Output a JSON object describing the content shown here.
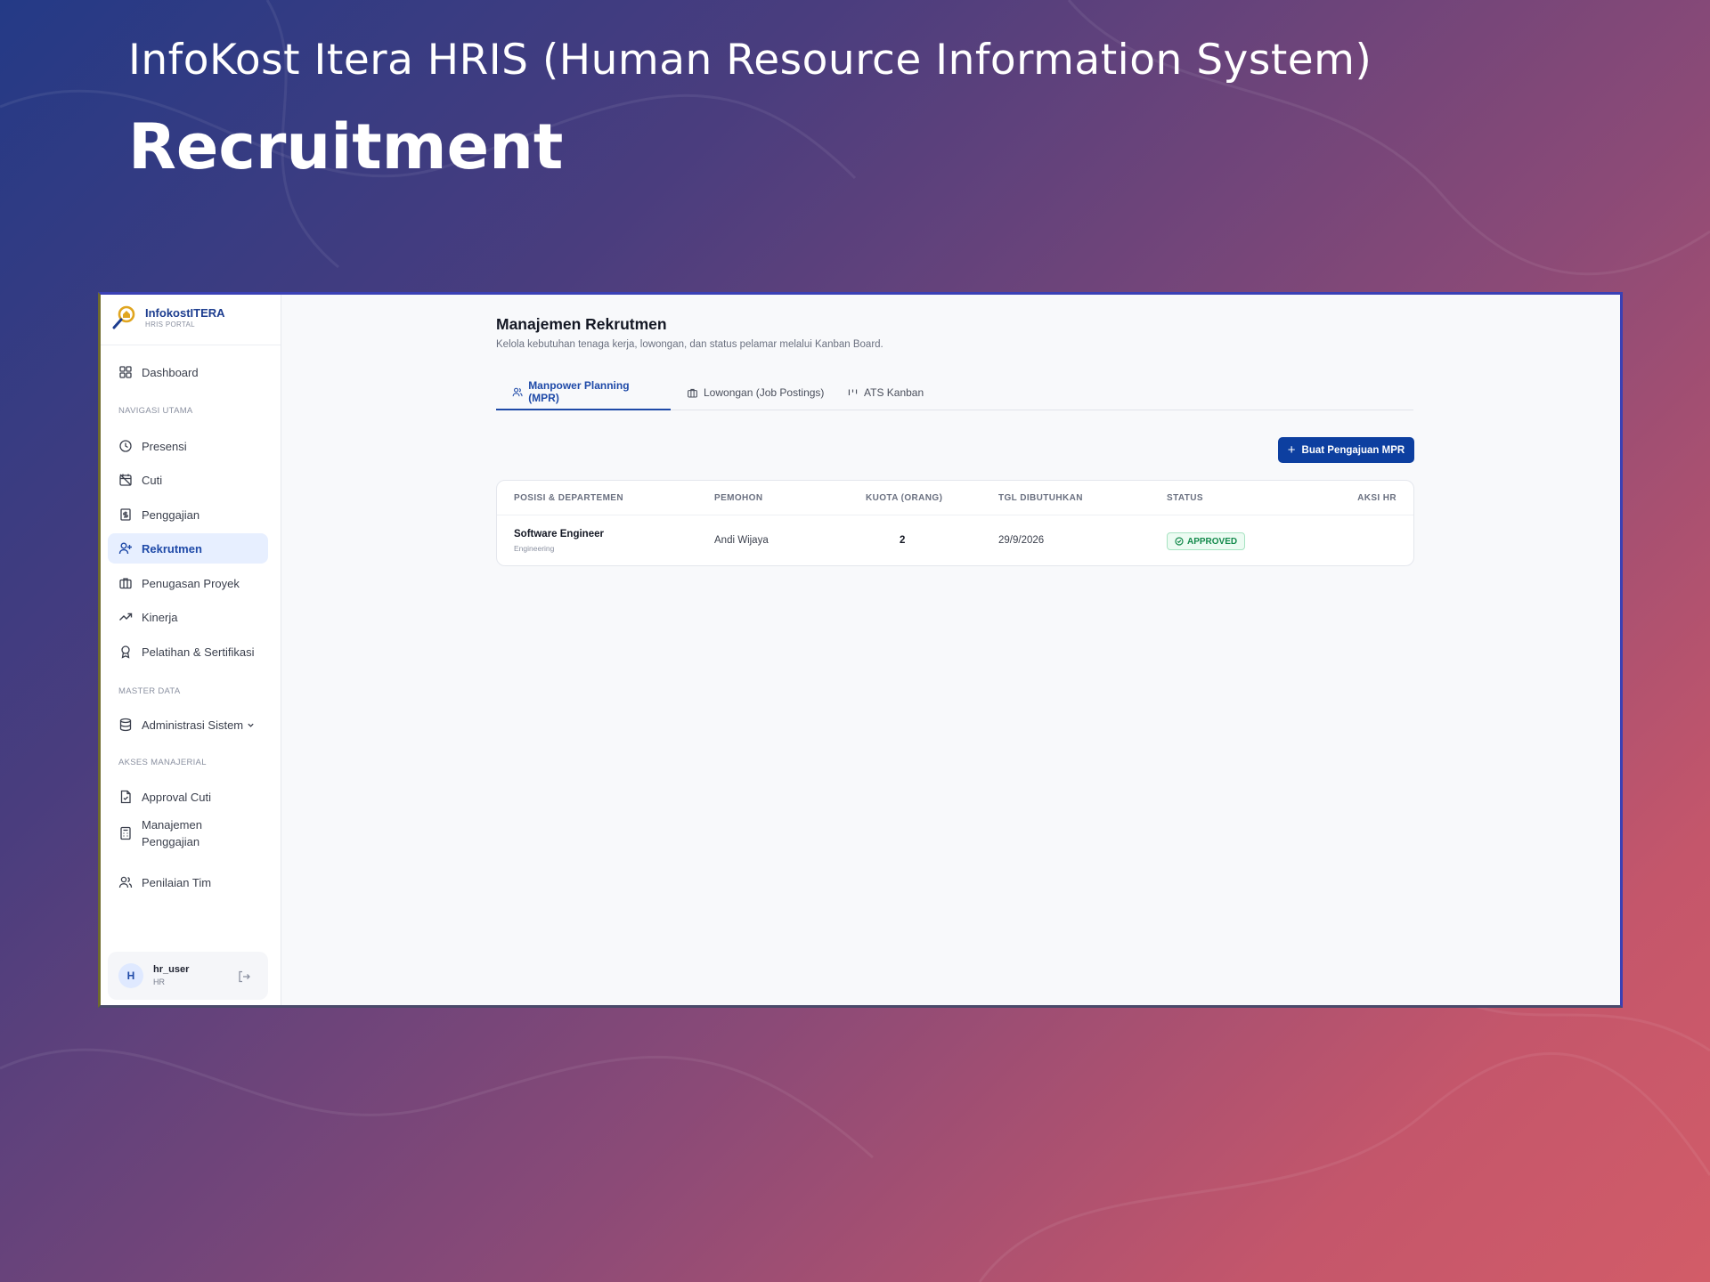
{
  "slide": {
    "subtitle": "InfoKost Itera HRIS (Human Resource Information System)",
    "title": "Recruitment"
  },
  "brand": {
    "name": "InfokostITERA",
    "tagline": "HRIS PORTAL",
    "color": "#1d3d8f"
  },
  "sidebar": {
    "dashboard": "Dashboard",
    "sections": {
      "main": "NAVIGASI UTAMA",
      "master": "MASTER DATA",
      "managerial": "AKSES MANAJERIAL"
    },
    "items": {
      "presensi": "Presensi",
      "cuti": "Cuti",
      "penggajian": "Penggajian",
      "rekrutmen": "Rekrutmen",
      "proyek": "Penugasan Proyek",
      "kinerja": "Kinerja",
      "pelatihan": "Pelatihan & Sertifikasi",
      "admin": "Administrasi Sistem",
      "approval": "Approval Cuti",
      "manajemen_gaji_1": "Manajemen",
      "manajemen_gaji_2": "Penggajian",
      "penilaian": "Penilaian Tim"
    },
    "active_item": "Rekrutmen"
  },
  "user": {
    "initial": "H",
    "name": "hr_user",
    "role": "HR"
  },
  "page": {
    "title": "Manajemen Rekrutmen",
    "description": "Kelola kebutuhan tenaga kerja, lowongan, dan status pelamar melalui Kanban Board."
  },
  "tabs": [
    {
      "label": "Manpower Planning (MPR)",
      "icon": "users-icon",
      "active": true
    },
    {
      "label": "Lowongan (Job Postings)",
      "icon": "briefcase-icon",
      "active": false
    },
    {
      "label": "ATS Kanban",
      "icon": "kanban-icon",
      "active": false
    }
  ],
  "actions": {
    "add_mpr": "Buat Pengajuan MPR"
  },
  "table": {
    "headers": [
      "POSISI & DEPARTEMEN",
      "PEMOHON",
      "KUOTA (ORANG)",
      "TGL DIBUTUHKAN",
      "STATUS",
      "AKSI HR"
    ],
    "rows": [
      {
        "position": "Software Engineer",
        "department": "Engineering",
        "requester": "Andi Wijaya",
        "quota": "2",
        "date_needed": "29/9/2026",
        "status": "APPROVED"
      }
    ]
  },
  "colors": {
    "accent": "#1f4aa8",
    "button": "#0d3fa0",
    "approved": "#148a4c"
  }
}
